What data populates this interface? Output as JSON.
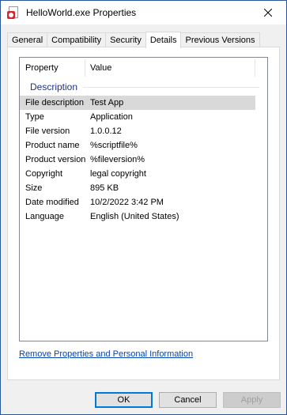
{
  "window": {
    "title": "HelloWorld.exe Properties"
  },
  "tabs": [
    {
      "label": "General"
    },
    {
      "label": "Compatibility"
    },
    {
      "label": "Security"
    },
    {
      "label": "Details"
    },
    {
      "label": "Previous Versions"
    }
  ],
  "active_tab": "Details",
  "details": {
    "header": {
      "property": "Property",
      "value": "Value"
    },
    "group": "Description",
    "rows": [
      {
        "property": "File description",
        "value": "Test App"
      },
      {
        "property": "Type",
        "value": "Application"
      },
      {
        "property": "File version",
        "value": "1.0.0.12"
      },
      {
        "property": "Product name",
        "value": "%scriptfile%"
      },
      {
        "property": "Product version",
        "value": "%fileversion%"
      },
      {
        "property": "Copyright",
        "value": "legal copyright"
      },
      {
        "property": "Size",
        "value": "895 KB"
      },
      {
        "property": "Date modified",
        "value": "10/2/2022 3:42 PM"
      },
      {
        "property": "Language",
        "value": "English (United States)"
      }
    ]
  },
  "remove_link": "Remove Properties and Personal Information",
  "buttons": {
    "ok": "OK",
    "cancel": "Cancel",
    "apply": "Apply"
  },
  "colors": {
    "link": "#0645ad",
    "group_header": "#1e3287",
    "default_button_border": "#0078d7",
    "selection": "#d9d9d9"
  }
}
